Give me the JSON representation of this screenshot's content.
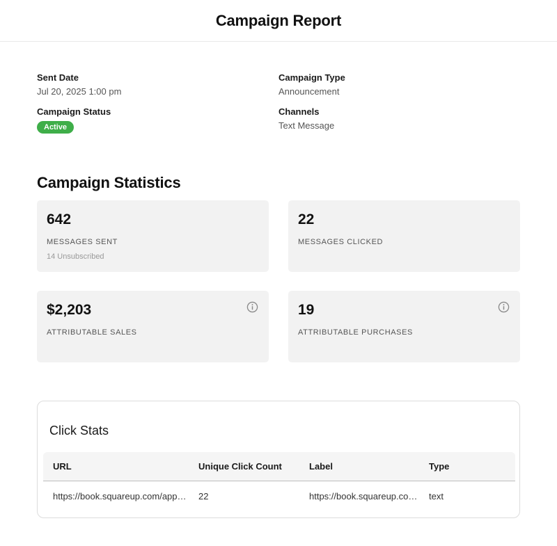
{
  "header": {
    "title": "Campaign Report"
  },
  "details": {
    "sent_date_label": "Sent Date",
    "sent_date_value": "Jul 20, 2025 1:00 pm",
    "campaign_type_label": "Campaign Type",
    "campaign_type_value": "Announcement",
    "campaign_status_label": "Campaign Status",
    "campaign_status_value": "Active",
    "channels_label": "Channels",
    "channels_value": "Text Message"
  },
  "colors": {
    "status_active": "#3fae49",
    "card_bg": "#f2f2f2"
  },
  "statistics": {
    "title": "Campaign Statistics",
    "cards": [
      {
        "value": "642",
        "label": "MESSAGES SENT",
        "sub": "14 Unsubscribed",
        "icon": null
      },
      {
        "value": "22",
        "label": "MESSAGES CLICKED",
        "sub": "",
        "icon": null
      },
      {
        "value": "$2,203",
        "label": "ATTRIBUTABLE SALES",
        "sub": "",
        "icon": "info-icon"
      },
      {
        "value": "19",
        "label": "ATTRIBUTABLE PURCHASES",
        "sub": "",
        "icon": "info-icon"
      }
    ]
  },
  "click_stats": {
    "title": "Click Stats",
    "columns": [
      "URL",
      "Unique Click Count",
      "Label",
      "Type"
    ],
    "rows": [
      [
        "https://book.squareup.com/appoi...",
        "22",
        "https://book.squareup.com...",
        "text"
      ]
    ]
  }
}
